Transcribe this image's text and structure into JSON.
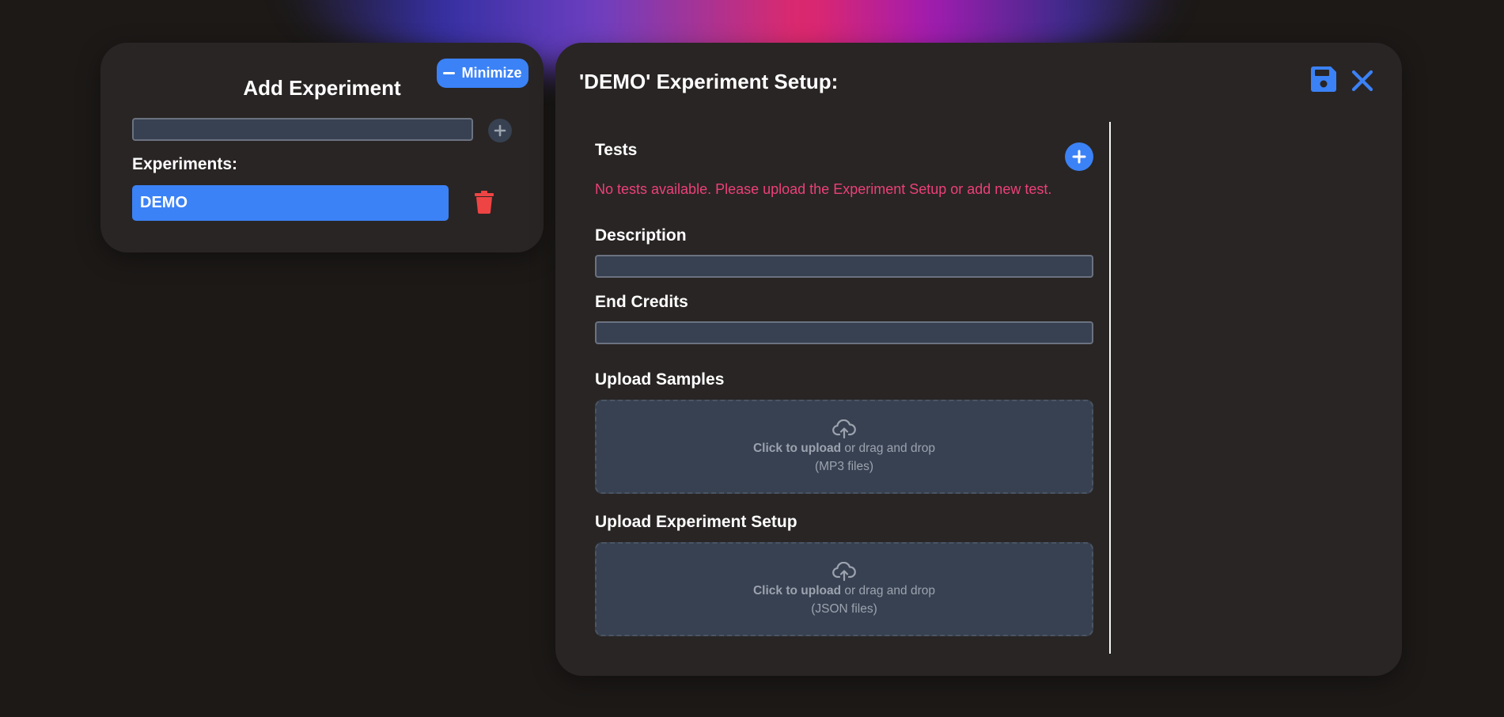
{
  "colors": {
    "background": "#1c1917",
    "panel": "#292524",
    "accent": "#3b82f6",
    "danger": "#ef4444",
    "warning_text": "#ec407a",
    "dropzone": "#374151"
  },
  "left_panel": {
    "title": "Add Experiment",
    "minimize_label": "Minimize",
    "new_experiment_value": "",
    "experiments_label": "Experiments:",
    "experiments": [
      {
        "name": "DEMO",
        "selected": true
      }
    ],
    "icons": {
      "minimize": "minus-icon",
      "add": "plus-icon",
      "delete": "trash-icon"
    }
  },
  "right_panel": {
    "title": "'DEMO' Experiment Setup:",
    "icons": {
      "save": "floppy-disk-icon",
      "close": "x-icon",
      "add_test": "plus-circle-icon"
    },
    "tests": {
      "label": "Tests",
      "empty_message": "No tests available. Please upload the Experiment Setup or add new test."
    },
    "description": {
      "label": "Description",
      "value": ""
    },
    "end_credits": {
      "label": "End Credits",
      "value": ""
    },
    "upload_samples": {
      "label": "Upload Samples",
      "click_text": "Click to upload",
      "drag_text": " or drag and drop",
      "file_types": "(MP3 files)",
      "icon": "cloud-upload-icon"
    },
    "upload_setup": {
      "label": "Upload Experiment Setup",
      "click_text": "Click to upload",
      "drag_text": " or drag and drop",
      "file_types": "(JSON files)",
      "icon": "cloud-upload-icon"
    }
  }
}
